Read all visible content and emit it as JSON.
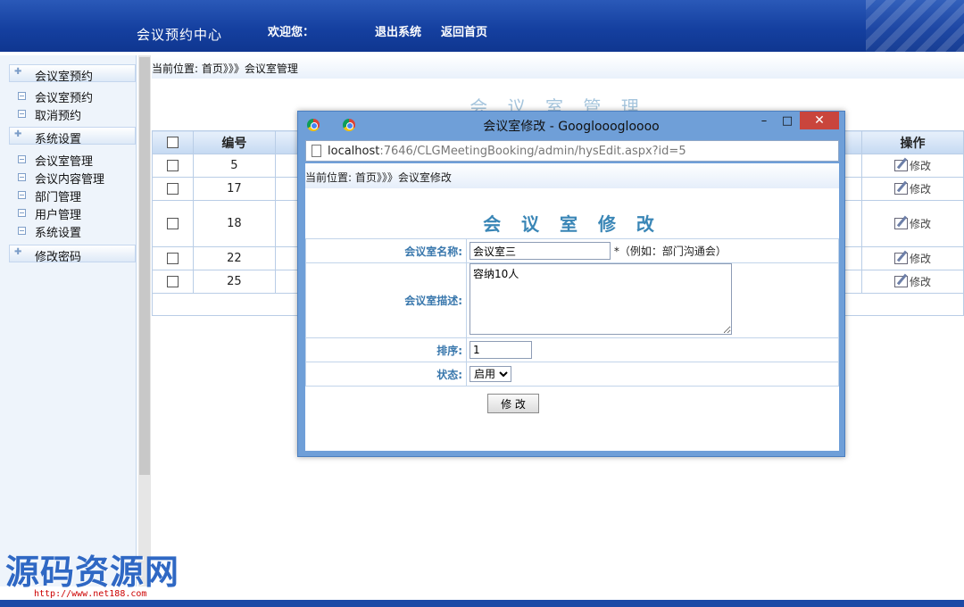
{
  "header": {
    "brand": "会议预约中心",
    "welcome": "欢迎您：",
    "logout": "退出系统",
    "home": "返回首页"
  },
  "sidebar": {
    "groups": [
      {
        "label": "会议室预约",
        "items": [
          "会议室预约",
          "取消预约"
        ]
      },
      {
        "label": "系统设置",
        "items": [
          "会议室管理",
          "会议内容管理",
          "部门管理",
          "用户管理",
          "系统设置"
        ]
      },
      {
        "label": "修改密码",
        "items": []
      }
    ]
  },
  "main": {
    "breadcrumb": "当前位置: 首页》》》会议室管理",
    "title": "会 议 室 管 理",
    "columns": {
      "id": "编号",
      "action": "操作"
    },
    "rows": [
      {
        "id": "5",
        "action": "修改"
      },
      {
        "id": "17",
        "action": "修改"
      },
      {
        "id": "18",
        "action": "修改"
      },
      {
        "id": "22",
        "action": "修改"
      },
      {
        "id": "25",
        "action": "修改"
      }
    ]
  },
  "modal": {
    "window_title": "会议室修改 - Googlooogloooo",
    "minimize": "–",
    "maximize": "□",
    "close": "✕",
    "url_host": "localhost",
    "url_path": ":7646/CLGMeetingBooking/admin/hysEdit.aspx?id=5",
    "breadcrumb": "当前位置: 首页》》》会议室修改",
    "form_title": "会 议 室 修 改",
    "name_label": "会议室名称:",
    "name_value": "会议室三",
    "name_hint": "*（例如：部门沟通会）",
    "desc_label": "会议室描述:",
    "desc_value": "容纳10人",
    "order_label": "排序:",
    "order_value": "1",
    "status_label": "状态:",
    "status_value": "启用",
    "submit": "修 改"
  },
  "watermark": {
    "title": "源码资源网",
    "url": "http://www.net188.com"
  }
}
